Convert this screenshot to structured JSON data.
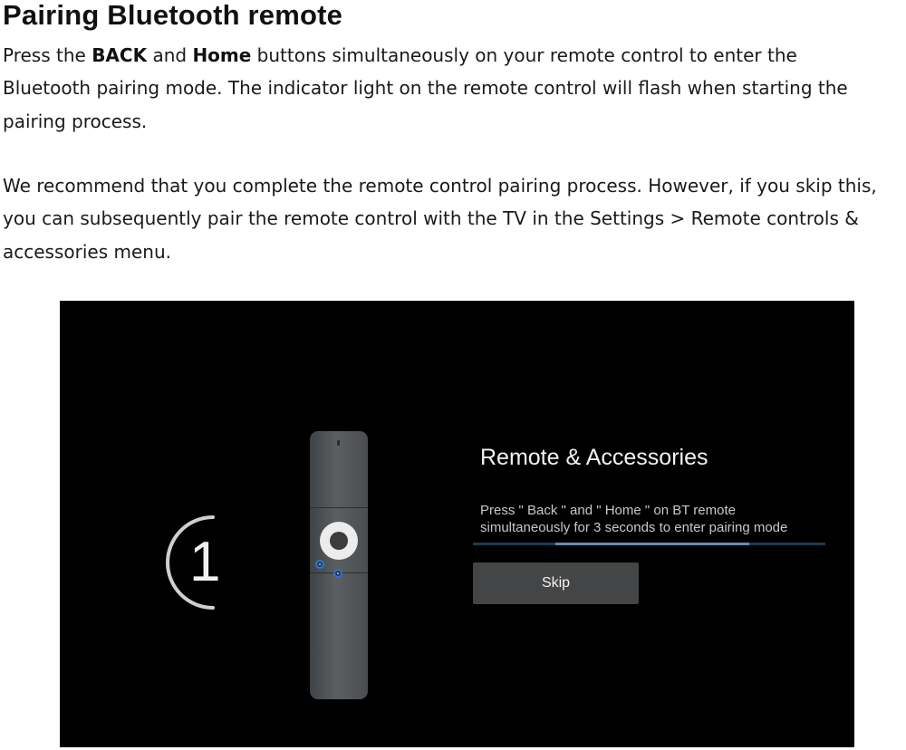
{
  "document": {
    "title": "Pairing Bluetooth remote",
    "para1": {
      "line1_pre": "Press the ",
      "line1_bold1": "BACK",
      "line1_mid": " and ",
      "line1_bold2": "Home",
      "line1_post": " buttons simultaneously on your remote control to enter the",
      "line2": "Bluetooth pairing mode. The indicator light on the remote control will flash when starting the",
      "line3": "pairing process."
    },
    "para2": {
      "line1": "We recommend that you complete the remote control pairing process. However, if you skip this,",
      "line2": "you can subsequently pair the remote control with the TV in the Settings > Remote controls &",
      "line3": "accessories menu."
    }
  },
  "tv_screen": {
    "countdown": "1",
    "panel_title": "Remote & Accessories",
    "instruction_line1": "Press \" Back \" and \" Home \" on BT remote",
    "instruction_line2": "simultaneously for 3 seconds to enter pairing mode",
    "skip_label": "Skip",
    "progress_fraction": 0.55,
    "colors": {
      "background": "#000000",
      "progress_track": "#1e3c52",
      "progress_fill": "#5d8fb3",
      "skip_button": "#444546",
      "remote_button_glow": "#2f74d0"
    },
    "icons": [
      "countdown-arc-icon",
      "remote-control-icon"
    ]
  }
}
